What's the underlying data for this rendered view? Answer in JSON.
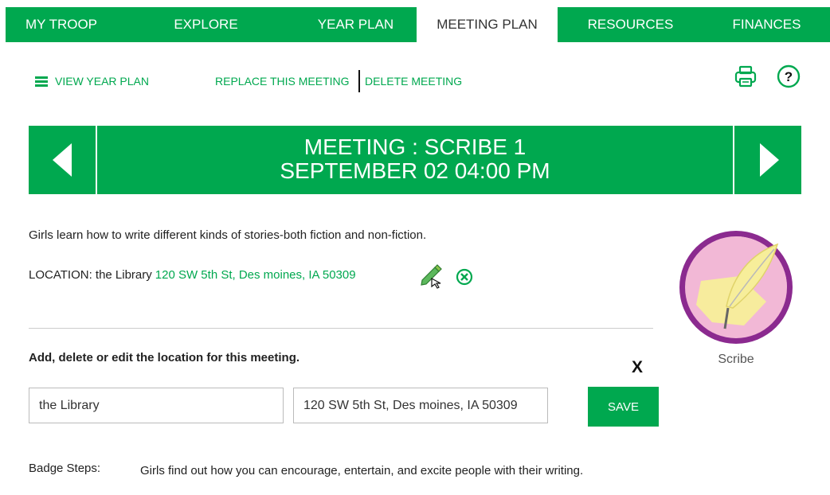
{
  "nav": {
    "tabs": [
      {
        "label": "MY TROOP"
      },
      {
        "label": "EXPLORE"
      },
      {
        "label": "YEAR PLAN"
      },
      {
        "label": "MEETING PLAN",
        "active": true
      },
      {
        "label": "RESOURCES"
      },
      {
        "label": "FINANCES"
      }
    ]
  },
  "toolbar": {
    "view_year_plan": "VIEW YEAR PLAN",
    "replace_meeting": "REPLACE THIS MEETING",
    "delete_meeting": "DELETE MEETING",
    "print_icon": "print-icon",
    "help_icon": "help-icon"
  },
  "banner": {
    "title": "MEETING : SCRIBE 1",
    "date": "SEPTEMBER 02 04:00 PM"
  },
  "meeting": {
    "description": "Girls learn how to write different kinds of stories-both fiction and non-fiction.",
    "location_label": "LOCATION: the Library",
    "location_address": "120 SW 5th St, Des moines, IA 50309"
  },
  "location_editor": {
    "instruction": "Add, delete or edit the location for this meeting.",
    "close_label": "X",
    "name_value": "the Library",
    "address_value": "120 SW 5th St, Des moines, IA 50309",
    "save_label": "SAVE"
  },
  "badge": {
    "caption": "Scribe"
  },
  "badge_steps": {
    "label": "Badge Steps:",
    "text": "Girls find out how you can encourage, entertain, and excite people with their writing."
  },
  "colors": {
    "brand_green": "#00a84f",
    "badge_purple": "#8b2a8f",
    "badge_pink": "#f2b8d6",
    "badge_yellow": "#f7ee9a"
  }
}
